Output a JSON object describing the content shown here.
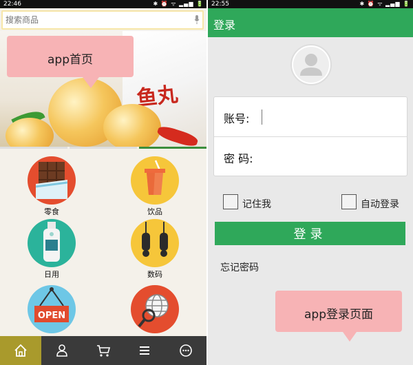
{
  "left_screen": {
    "status_bar": {
      "time": "22:46",
      "icons": "✱ ⏰ ᯤ ▂▄▆ 🔋"
    },
    "search": {
      "placeholder": "搜索商品"
    },
    "banner": {
      "package_text": "鱼丸",
      "annotation": "app首页"
    },
    "categories": [
      {
        "label": "零食",
        "icon": "chocolate-icon"
      },
      {
        "label": "饮品",
        "icon": "drink-cup-icon"
      },
      {
        "label": "日用",
        "icon": "lotion-bottle-icon"
      },
      {
        "label": "数码",
        "icon": "earphones-icon"
      },
      {
        "label": "",
        "icon": "open-sign-icon",
        "sign_text": "OPEN"
      },
      {
        "label": "",
        "icon": "globe-search-icon"
      }
    ],
    "tabs": [
      {
        "icon": "home-icon",
        "active": true
      },
      {
        "icon": "user-icon",
        "active": false
      },
      {
        "icon": "cart-icon",
        "active": false
      },
      {
        "icon": "menu-icon",
        "active": false
      },
      {
        "icon": "more-icon",
        "active": false
      }
    ],
    "colors": {
      "active_tab": "#a99a2c",
      "tabbar": "#3a3a3a",
      "banner_dot_active": "#3b8e3c"
    }
  },
  "right_screen": {
    "status_bar": {
      "time": "22:55",
      "icons": "✱ ⏰ ᯤ ▂▄▆ 🔋"
    },
    "title": "登录",
    "form": {
      "account_label": "账号:",
      "password_label": "密 码:",
      "account_value": "",
      "password_value": ""
    },
    "remember_me": "记住我",
    "auto_login": "自动登录",
    "login_button": "登录",
    "forgot_password": "忘记密码",
    "annotation": "app登录页面",
    "colors": {
      "accent": "#2fa85a",
      "annotation_bg": "#f7b3b5"
    }
  }
}
